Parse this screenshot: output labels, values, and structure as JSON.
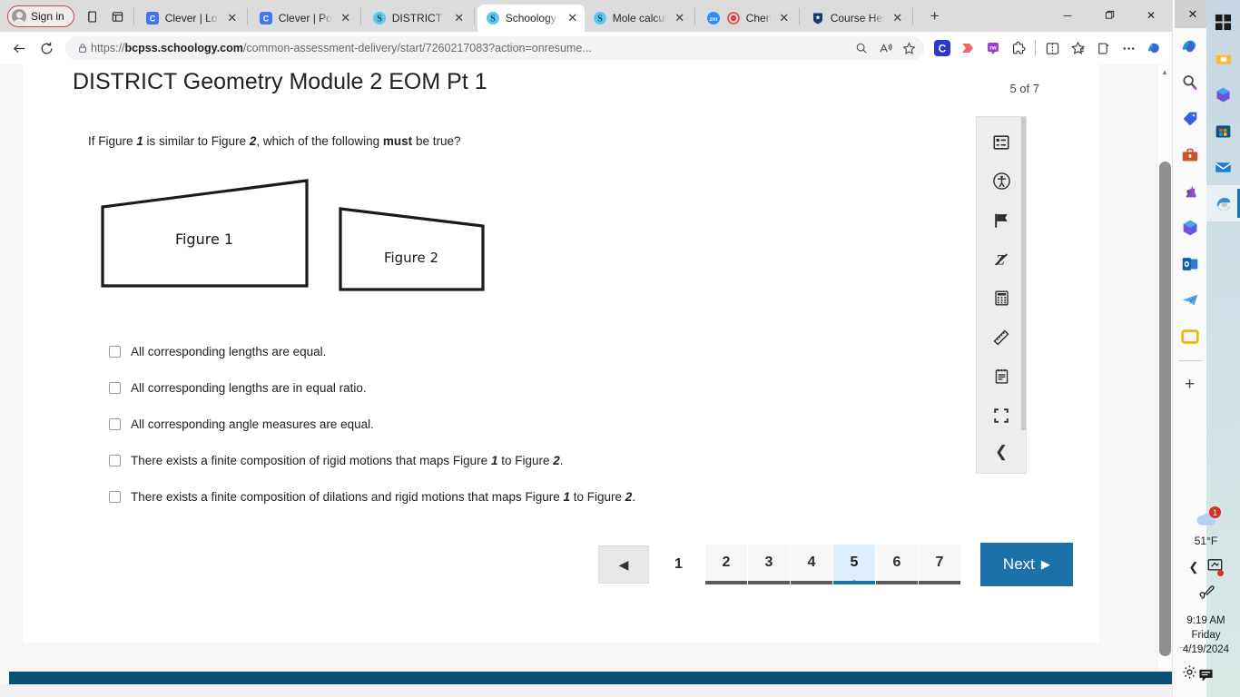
{
  "browser": {
    "signin_label": "Sign in",
    "tabs": [
      {
        "title": "Clever | Log",
        "favicon": "clever-icon",
        "active": false
      },
      {
        "title": "Clever | Port",
        "favicon": "clever-icon",
        "active": false
      },
      {
        "title": "DISTRICT Ge",
        "favicon": "schoology-icon",
        "active": false
      },
      {
        "title": "Schoology",
        "favicon": "schoology-icon",
        "active": true
      },
      {
        "title": "Mole calcula",
        "favicon": "schoology-icon",
        "active": false
      },
      {
        "title": "Chemis",
        "favicon": "zoom-icon",
        "active": false
      },
      {
        "title": "Course Hero",
        "favicon": "coursehero-icon",
        "active": false
      }
    ],
    "new_tab_label": "+",
    "window_controls": {
      "minimize": "─",
      "maximize": "❐",
      "close": "✕"
    },
    "url_prefix": "https://",
    "url_host": "bcpss.schoology.com",
    "url_path": "/common-assessment-delivery/start/7260217083?action=onresume...",
    "toolbar_icons": [
      "back-icon",
      "refresh-icon",
      "zoom-icon",
      "read-aloud-icon",
      "favorite-icon",
      "clever-extension-icon",
      "imagus-extension-icon",
      "readwrite-extension-icon",
      "extensions-icon",
      "split-screen-icon",
      "collections-icon",
      "add-to-collection-icon",
      "more-icon",
      "copilot-icon"
    ]
  },
  "assessment": {
    "title": "DISTRICT Geometry Module 2 EOM Pt 1",
    "page_counter": "5 of 7",
    "question": {
      "pre": "If Figure ",
      "fig1": "1",
      "mid": " is similar to Figure ",
      "fig2": "2",
      "mid2": ", which of the following ",
      "emphasis": "must",
      "post": " be true?"
    },
    "figures": [
      {
        "label": "Figure 1"
      },
      {
        "label": "Figure 2"
      }
    ],
    "choices": [
      {
        "text": "All corresponding lengths are equal.",
        "checked": false
      },
      {
        "text": "All corresponding lengths are in equal ratio.",
        "checked": false
      },
      {
        "text": "All corresponding angle measures are equal.",
        "checked": false
      },
      {
        "text": "There exists a finite composition of rigid motions that maps Figure 1 to Figure 2.",
        "checked": false
      },
      {
        "text": "There exists a finite composition of dilations and rigid motions that maps Figure 1 to Figure 2.",
        "checked": false
      }
    ],
    "pager": {
      "prev_label": "◀",
      "first": "1",
      "numbers": [
        "2",
        "3",
        "4",
        "5",
        "6",
        "7"
      ],
      "current": "5",
      "next_label": "Next",
      "next_arrow": "▶"
    },
    "tools": [
      {
        "name": "answer-eliminator-icon"
      },
      {
        "name": "accessibility-icon"
      },
      {
        "name": "flag-icon"
      },
      {
        "name": "strikethrough-icon"
      },
      {
        "name": "calculator-icon"
      },
      {
        "name": "ruler-icon"
      },
      {
        "name": "notepad-icon"
      },
      {
        "name": "fullscreen-icon"
      }
    ],
    "tool_collapse": "❮",
    "colors": {
      "accent": "#1c72a8",
      "current_page_bg": "#ddeffc",
      "next_button": "#1c72a8"
    }
  },
  "windows": {
    "sidebar_close": "✕",
    "sidebar_icons": [
      "copilot-icon",
      "search-icon",
      "shopping-tag-icon",
      "tools-icon",
      "games-icon",
      "office-icon",
      "outlook-icon",
      "telegram-icon",
      "window-icon"
    ],
    "sidebar_add": "+",
    "sidebar_settings": "gear-icon",
    "taskbar_icons": [
      "start-icon",
      "file-explorer-icon",
      "office-icon",
      "microsoft-store-icon",
      "mail-icon",
      "edge-icon"
    ],
    "weather": {
      "temperature": "51°F",
      "badge": "1",
      "icon": "cloud-icon"
    },
    "tray": {
      "chevron": "❮",
      "screen_icon": "screen-share-icon",
      "pen_icon": "pen-icon",
      "chat_icon": "chat-icon"
    },
    "clock": {
      "time": "9:19 AM",
      "day": "Friday",
      "date": "4/19/2024"
    }
  }
}
